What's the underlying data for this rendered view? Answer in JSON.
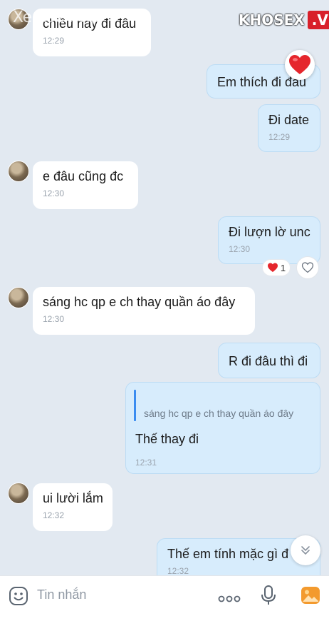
{
  "watermarks": {
    "left": "Xemsex.vip",
    "right_main": "KHOSEX",
    "right_vip": ".VIP"
  },
  "messages": [
    {
      "text": "chiều nay đi đâu",
      "time": "12:29"
    },
    {
      "text": "Em thích đi đâu",
      "time": ""
    },
    {
      "text": "Đi date",
      "time": "12:29"
    },
    {
      "text": "e đâu cũng đc",
      "time": "12:30"
    },
    {
      "text": "Đi lượn lờ unc",
      "time": "12:30"
    },
    {
      "text": "sáng hc qp e ch thay quần áo đây",
      "time": "12:30"
    },
    {
      "text": "R đi đâu thì đi",
      "time": ""
    },
    {
      "text": "Thế thay đi",
      "time": "12:31",
      "quote": "sáng hc qp e ch thay quần áo đây"
    },
    {
      "text": "ui lười lắm",
      "time": "12:32"
    },
    {
      "text": "Thế em tính mặc gì đ",
      "time": "12:32"
    }
  ],
  "reaction": {
    "count": "1"
  },
  "composer": {
    "placeholder": "Tin nhắn"
  },
  "colors": {
    "background": "#e2e9f1",
    "outgoing_bubble": "#d7ecfc",
    "incoming_bubble": "#ffffff",
    "heart": "#e5262c",
    "image_icon": "#f39a2e"
  },
  "icons": [
    "heart-icon",
    "heart-outline-icon",
    "chevron-double-down-icon",
    "emoji-icon",
    "more-icon",
    "mic-icon",
    "image-icon"
  ]
}
